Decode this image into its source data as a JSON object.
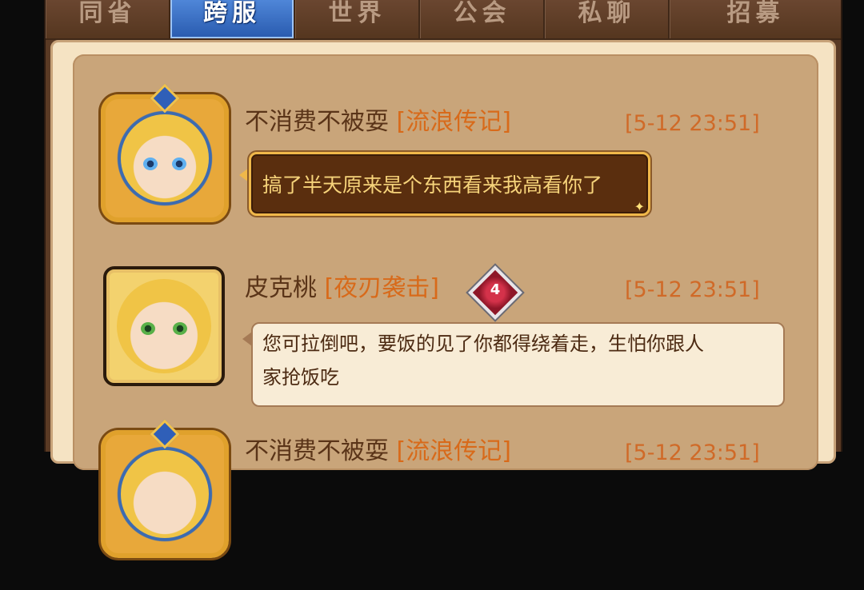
{
  "tabs": [
    {
      "label": "同省",
      "active": false
    },
    {
      "label": "跨服",
      "active": true
    },
    {
      "label": "世界",
      "active": false
    },
    {
      "label": "公会",
      "active": false
    },
    {
      "label": "私聊",
      "active": false
    },
    {
      "label": "招募",
      "active": false
    }
  ],
  "messages": [
    {
      "sender": "不消费不被耍",
      "guild": "[流浪传记]",
      "time": "[5-12 23:51]",
      "text": "搞了半天原来是个东西看来我高看你了",
      "bubble_style": "vip-dark",
      "avatar": "blonde-hero-gold-frame"
    },
    {
      "sender": "皮克桃",
      "guild": "[夜刃袭击]",
      "time": "[5-12 23:51]",
      "rank_badge": "4",
      "text_line1": "您可拉倒吧，要饭的见了你都得绕着走，生怕你跟人",
      "text_line2": "家抢饭吃",
      "bubble_style": "plain-light",
      "avatar": "blonde-girl-plain-frame"
    },
    {
      "sender": "不消费不被耍",
      "guild": "[流浪传记]",
      "time": "[5-12 23:51]",
      "avatar": "blonde-hero-gold-frame"
    }
  ],
  "colors": {
    "panel_bg": "#c9a57a",
    "active_tab": "#3a6fc8",
    "guild_text": "#d86a1a",
    "time_text": "#d06a28"
  }
}
